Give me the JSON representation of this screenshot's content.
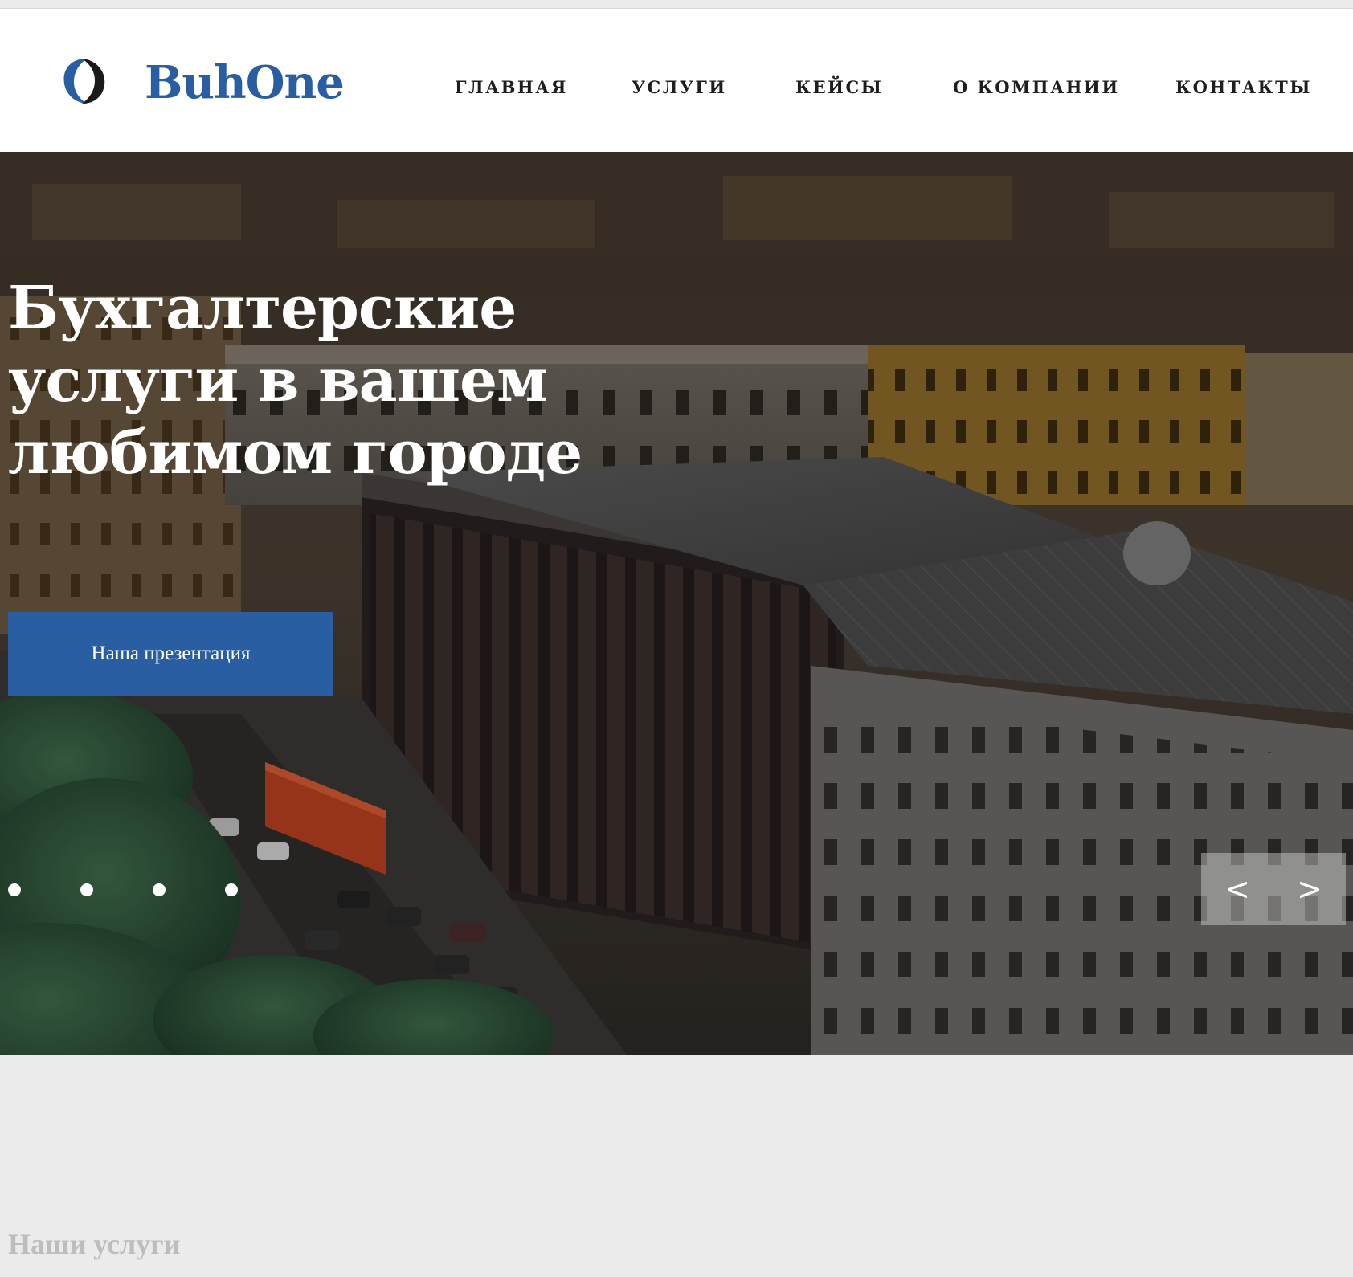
{
  "brand": {
    "name": "BuhOne",
    "color": "#2a5ea3"
  },
  "nav": {
    "items": [
      {
        "label": "ГЛАВНАЯ"
      },
      {
        "label": "УСЛУГИ"
      },
      {
        "label": "КЕЙСЫ"
      },
      {
        "label": "О КОМПАНИИ"
      },
      {
        "label": "КОНТАКТЫ"
      }
    ]
  },
  "hero": {
    "title": "Бухгалтерские услуги в вашем любимом городе",
    "button_label": "Наша презентация",
    "slides_count": 4,
    "prev_label": "<",
    "next_label": ">",
    "background_icon": "city-aerial-photo"
  },
  "services": {
    "title": "Наши услуги"
  },
  "colors": {
    "accent": "#2a5ea3",
    "nav_text": "#1e1e1e",
    "page_bg": "#ebebeb"
  }
}
